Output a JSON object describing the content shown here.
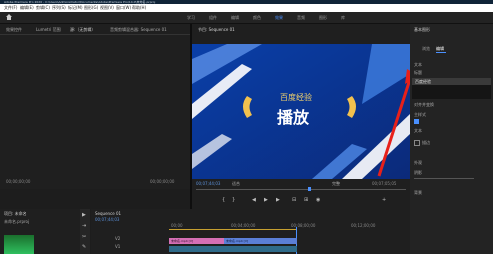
{
  "window": {
    "title": "Adobe Premiere Pro 2020 - C:\\Users\\Administrator\\Documents\\Adobe\\Premiere Pro\\14.0\\未命名.prproj"
  },
  "menu": [
    "文件(F)",
    "编辑(E)",
    "剪辑(C)",
    "序列(S)",
    "标记(M)",
    "图形(G)",
    "视图(V)",
    "窗口(W)",
    "帮助(H)"
  ],
  "workspaces": [
    "学习",
    "组件",
    "编辑",
    "颜色",
    "效果",
    "音频",
    "图形",
    "库"
  ],
  "source_panel": {
    "tab1": "效果控件",
    "tab2": "Lumetri 范围",
    "tab3": "源:（无剪辑）",
    "tab4": "音频剪辑混合器: Sequence 01",
    "tc_left": "00;00;00;00",
    "tc_right": "00;00;00;00"
  },
  "program": {
    "title": "节目: Sequence 01",
    "timecode": "00;07;44;03",
    "fit": "适合",
    "quality": "完整",
    "duration": "00;07;05;05",
    "video_text1": "百度经验",
    "video_text2": "播放"
  },
  "project": {
    "title": "项目: 未命名",
    "search_label": "未命名.prproj"
  },
  "timeline": {
    "title": "Sequence 01",
    "timecode": "00;07;44;03",
    "ruler": [
      "00;00",
      "00;04;00;00",
      "00;08;00;00",
      "00;12;00;00"
    ],
    "clip1": "未命名.mp4 [V]",
    "clip2": "未命名.mp4 [V]",
    "tracks": [
      "V3",
      "V2",
      "V1"
    ]
  },
  "essential_graphics": {
    "title": "基本图形",
    "tab_browse": "浏览",
    "tab_edit": "编辑",
    "section_text": "文本",
    "layer_label": "标题",
    "layer_value": "百度经验",
    "align_label": "对齐并变换",
    "style_label": "主样式",
    "text_label": "文本",
    "checkbox_label": "描边",
    "appearance_label": "外观",
    "shadow_label": "阴影",
    "extra_label": "背景"
  },
  "colors": {
    "accent": "#4a90ff",
    "arrow": "#e8201a"
  }
}
